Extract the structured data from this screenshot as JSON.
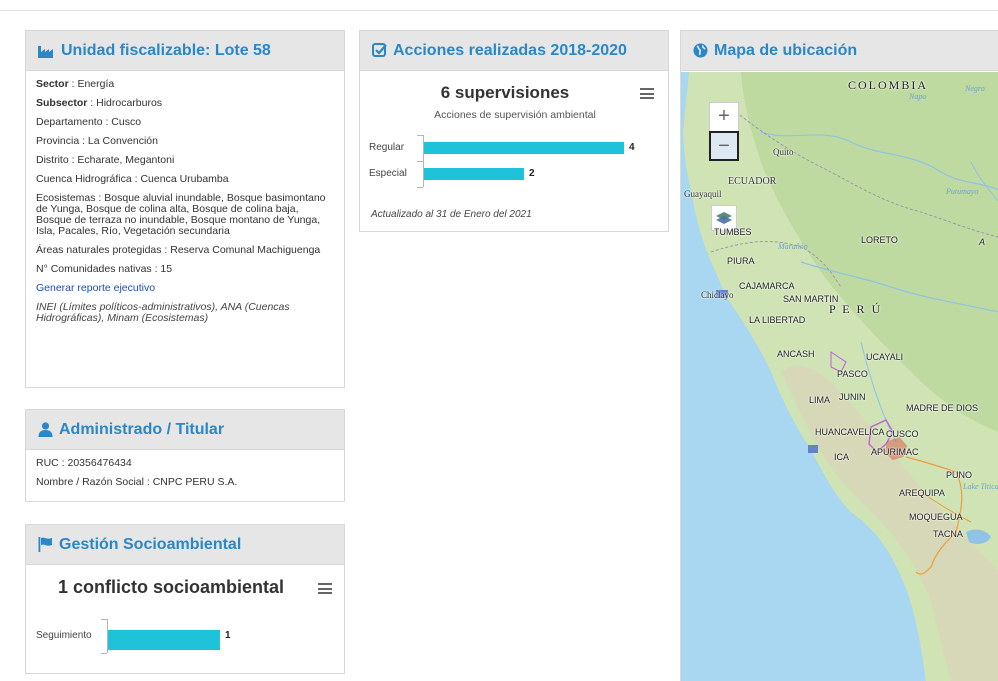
{
  "colors": {
    "accent": "#2a87c8",
    "bar": "#1ec3da",
    "header_bg": "#e6e6e6",
    "highlight_polygon": "#e01b1b",
    "purple_polygon": "#c05cd6",
    "orange_border": "#f19a3e"
  },
  "unidad": {
    "icon": "industry-icon",
    "title": "Unidad fiscalizable: Lote 58",
    "sector_label": "Sector",
    "sector_value": " : Energía",
    "subsector_label": "Subsector",
    "subsector_value": " : Hidrocarburos",
    "departamento": "Departamento : Cusco",
    "provincia": "Provincia : La Convención",
    "distrito": "Distrito : Echarate, Megantoni",
    "cuenca": "Cuenca Hidrográfica : Cuenca Urubamba",
    "ecosistemas": "Ecosistemas : Bosque aluvial inundable, Bosque basimontano de Yunga, Bosque de colina alta, Bosque de colina baja, Bosque de terraza no inundable, Bosque montano de Yunga, Isla, Pacales, Río, Vegetación secundaria",
    "areas": "Áreas naturales protegidas : Reserva Comunal Machiguenga",
    "comunidades": "N° Comunidades nativas : 15",
    "reporte_link": "Generar reporte ejecutivo",
    "fuentes": "INEI (Límites políticos-administrativos), ANA (Cuencas Hidrográficas), Minam (Ecosistemas)"
  },
  "administrado": {
    "icon": "user-icon",
    "title": "Administrado / Titular",
    "ruc": "RUC : 20356476434",
    "nombre": "Nombre / Razón Social : CNPC PERU S.A."
  },
  "gestion": {
    "icon": "flag-icon",
    "title": "Gestión Socioambiental",
    "chart_title": "1 conflicto socioambiental"
  },
  "acciones": {
    "icon": "check-square-icon",
    "title": "Acciones realizadas 2018-2020",
    "chart_title": "6 supervisiones",
    "chart_subtitle": "Acciones de supervisión ambiental",
    "updated": "Actualizado al 31 de Enero del 2021"
  },
  "mapa": {
    "icon": "globe-icon",
    "title": "Mapa de ubicación",
    "zoom_in": "+",
    "zoom_out": "−",
    "labels": {
      "colombia": "COLOMBIA",
      "negro": "Negro",
      "ecuador": "ECUADOR",
      "quito": "Quito",
      "guayaquil": "Guayaquil",
      "tumbes": "TUMBES",
      "piura": "PIURA",
      "loreto": "LORETO",
      "a": "A",
      "chiclayo": "Chiclayo",
      "cajamarca": "CAJAMARCA",
      "san_martin": "SAN MARTIN",
      "peru": "P E R Ú",
      "la_libertad": "LA LIBERTAD",
      "ancash": "ANCASH",
      "ucayali": "UCAYALI",
      "pasco": "PASCO",
      "lima": "LIMA",
      "junin": "JUNIN",
      "madre_de_dios": "MADRE DE DIOS",
      "huancavelica": "HUANCAVELICA",
      "cusco": "CUSCO",
      "ica": "ICA",
      "apurimac": "APURIMAC",
      "puno": "PUNO",
      "arequipa": "AREQUIPA",
      "moquegua": "MOQUEGUA",
      "tacna": "TACNA",
      "maranon": "Marañón",
      "putumayo": "Putumayo",
      "napo": "Napo",
      "lake": "Lake Titicaca"
    }
  },
  "chart_data": [
    {
      "type": "bar",
      "title": "6 supervisiones",
      "subtitle": "Acciones de supervisión ambiental",
      "categories": [
        "Regular",
        "Especial"
      ],
      "values": [
        4,
        2
      ],
      "orientation": "horizontal",
      "xlim": [
        0,
        4
      ]
    },
    {
      "type": "bar",
      "title": "1 conflicto socioambiental",
      "categories": [
        "Seguimiento"
      ],
      "values": [
        1
      ],
      "orientation": "horizontal",
      "xlim": [
        0,
        1
      ]
    }
  ]
}
